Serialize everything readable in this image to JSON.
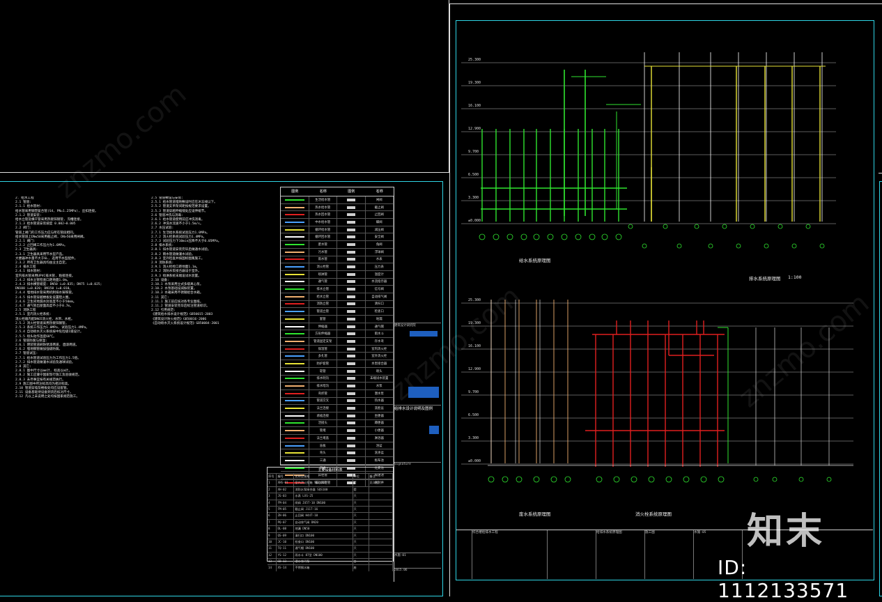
{
  "drawing": {
    "notes_left": "2. 给水工程\n2.1 管道:\n2.1.1 给水管材:\n给水管采用钢塑复合管(S4, PN=1.25MPa), 丝扣连接。\n2.1.2 管道安装:\n给水立管及横干管采用热镀锌钢管, 沟槽连接。\n2.1.3 给水管道安装坡度 0.002~0.005\n2.2 阀门:\n管道上阀门的工作压力应与所在管段相同。\n给水管道上DN≤50采用截止阀, DN>50采用闸阀。\n2.2.1 阀门:\n2.2.2 止回阀工作压力为1.6MPa。\n2.3 卫生器具:\n2.3.1 卫生器具采用节水型产品。\n大便器冲水量不大于6L, 选用节水型配件。\n2.3.2 所有卫生器具均由业主自定。\n2.4 排水工程\n2.4.1 排水管材:\n室内排水管采用UPVC排水管, 粘接连接。\n2.4.2 排水立管检查口距地面1.0m。\n2.4.3 排水横管坡度: DN50 i=0.035; DN75 i=0.025;\nDN100 i=0.020; DN150 i=0.010。\n2.4.4 埋地排水管采用机制排水铸铁管。\n2.4.5 排水管穿越楼板处设置阻火圈。\n2.4.6 卫生间地漏水封高度不小于50mm。\n2.4.7 通气管出屋面高度不小于0.7m。\n2.5 消防工程\n2.5.1 室内消火栓系统:\n消火栓箱内配DN65消火栓、水带、水枪。\n2.5.2 消火栓管道采用热镀锌钢管。\n2.5.3 系统工作压力1.0MPa, 试验压力1.4MPa。\n2.5.4 自动喷水灭火系统按中危险级I级设计。\n2.5.5 喷头动作温度68℃。\n2.6 管道防腐与保温:\n2.6.1 明装管道刷防锈漆两道, 面漆两道。\n2.6.2 埋地钢管做加强级防腐。\n2.7 管道试压:\n2.7.1 给水管道试验压力为工作压力1.5倍。\n2.7.2 排水管道做灌水试验及通球试验。\n2.8 其它:\n2.8.1 图中尺寸以mm计, 标高以m计。\n2.8.2 施工应遵守国家现行施工及验收规范。\n2.8.3 未尽事宜按有关规范执行。\n2.9 施工图中所注标高均为相对标高。\n2.10 管道穿墙及楼板处均应设套管。\n2.11 设备基础待设备到货后核对尺寸。\n2.12 凡以上未说明之处均按国家规范施工。",
    "notes_right": "2.5 管道敷设与安装:\n2.5.1 给水管道埋地敷设时应在冰冻线以下。\n2.5.2 管道支吊架间距按规范要求设置。\n2.5.3 管道穿越伸缩缝处应设伸缩节。\n2.6 管道冲洗与消毒:\n2.6.1 给水管道使用前应冲洗消毒。\n2.6.2 冲洗水流速不小于1.5m/s。\n2.7 水压试验:\n2.7.1 生活给水系统试验压力1.0MPa。\n2.7.2 消火栓系统试验压力1.4MPa。\n2.7.3 试验压力下10min压降不大于0.05MPa。\n2.8 排水系统:\n2.8.1 排水管道安装完毕后做通水试验。\n2.8.2 雨水管道做灌水试验。\n2.8.3 室外检查井按国标图集施工。\n2.9 消防系统:\n2.9.1 消火栓栓口距地面1.1m。\n2.9.2 消防水泵接合器设于室外。\n2.9.3 喷淋系统末端设试水装置。\n2.10 设备:\n2.10.1 水泵采用立式多级离心泵。\n2.10.2 水泵基础设减振装置。\n2.10.3 水箱采用不锈钢组合水箱。\n2.11 其它:\n2.11.1 施工前应核对各专业图纸。\n2.11.2 管道安装完毕后标注管道标识。\n2.12 引用规范:\n《建筑给水排水设计规范》GB50015-2003\n《建筑设计防火规范》GB50016-2006\n《自动喷水灭火系统设计规范》GB50084-2001",
    "legend_header": [
      "图例",
      "名称",
      "图例",
      "名称"
    ],
    "legend_rows": [
      [
        "生活给水管",
        "闸阀"
      ],
      [
        "热水给水管",
        "截止阀"
      ],
      [
        "热水回水管",
        "止回阀"
      ],
      [
        "中水给水管",
        "蝶阀"
      ],
      [
        "循环给水管",
        "减压阀"
      ],
      [
        "循环回水管",
        "安全阀"
      ],
      [
        "废水管",
        "角阀"
      ],
      [
        "污水管",
        "浮球阀"
      ],
      [
        "雨水管",
        "水表"
      ],
      [
        "消火栓管",
        "压力表"
      ],
      [
        "喷淋管",
        "温度计"
      ],
      [
        "通气管",
        "水流指示器"
      ],
      [
        "排水立管",
        "信号阀"
      ],
      [
        "给水立管",
        "自动排气阀"
      ],
      [
        "消防立管",
        "清扫口"
      ],
      [
        "管道立管",
        "检查口"
      ],
      [
        "套管",
        "地漏"
      ],
      [
        "伸缩器",
        "通气帽"
      ],
      [
        "方形伸缩器",
        "雨水斗"
      ],
      [
        "管道固定支架",
        "存水弯"
      ],
      [
        "保温管",
        "室内消火栓"
      ],
      [
        "多孔管",
        "室外消火栓"
      ],
      [
        "防护套管",
        "水泵接合器"
      ],
      [
        "软管",
        "喷头"
      ],
      [
        "排水明沟",
        "末端试水装置"
      ],
      [
        "排水暗沟",
        "水泵"
      ],
      [
        "弯折管",
        "潜水泵"
      ],
      [
        "管道交叉",
        "热水器"
      ],
      [
        "法兰连接",
        "洗脸盆"
      ],
      [
        "承插连接",
        "坐便器"
      ],
      [
        "活接头",
        "蹲便器"
      ],
      [
        "管堵",
        "小便器"
      ],
      [
        "法兰堵盖",
        "淋浴器"
      ],
      [
        "盲板",
        "浴盆"
      ],
      [
        "弯头",
        "洗涤盆"
      ],
      [
        "三通",
        "拖布池"
      ],
      [
        "四通",
        "化粪池"
      ],
      [
        "异径管",
        "隔油池"
      ],
      [
        "偏心异径管",
        "水封井"
      ]
    ],
    "equipment_table": {
      "title": "主要设备材料表",
      "headers": [
        "序号",
        "编号",
        "名称及规格",
        "单位",
        "备注"
      ],
      "rows": [
        [
          "1",
          "XHS-01",
          "室内消火栓箱 SG24A65",
          "套",
          "见详图"
        ],
        [
          "2",
          "XH-02",
          "消防水泵接合器 SQS100",
          "套",
          ""
        ],
        [
          "3",
          "JS-03",
          "水表 LXS-25",
          "只",
          ""
        ],
        [
          "4",
          "FM-04",
          "闸阀 Z45T-10 DN100",
          "只",
          ""
        ],
        [
          "5",
          "FM-05",
          "截止阀 J11T-16",
          "只",
          ""
        ],
        [
          "6",
          "ZH-06",
          "止回阀 H44T-10",
          "只",
          ""
        ],
        [
          "7",
          "PQ-07",
          "自动排气阀 DN20",
          "只",
          ""
        ],
        [
          "8",
          "DL-08",
          "地漏 DN50",
          "只",
          ""
        ],
        [
          "9",
          "QS-09",
          "清扫口 DN100",
          "只",
          ""
        ],
        [
          "10",
          "JC-10",
          "检查口 DN100",
          "只",
          ""
        ],
        [
          "11",
          "TQ-11",
          "通气帽 DN100",
          "只",
          ""
        ],
        [
          "12",
          "YS-12",
          "雨水斗 87型 DN100",
          "只",
          ""
        ],
        [
          "13",
          "SB-13",
          "潜水排污泵",
          "台",
          ""
        ],
        [
          "14",
          "XS-14",
          "不锈钢水箱",
          "座",
          ""
        ]
      ]
    },
    "captions": {
      "water_supply_system": "给水系统原理图",
      "drain_system_1": "排水系统原理图",
      "drain_system_2": "废水系统原理图",
      "fire_system": "消火栓系统原理图",
      "scale": "1:100"
    },
    "levels_top": [
      "25.300",
      "19.300",
      "16.100",
      "12.900",
      "9.700",
      "6.500",
      "3.300",
      "±0.000"
    ],
    "levels_bottom": [
      "25.300",
      "19.300",
      "16.100",
      "12.900",
      "9.700",
      "6.500",
      "3.300",
      "±0.000"
    ],
    "titleblock": {
      "project": "给排水设计说明及图例",
      "company": "建筑设计研究院",
      "drawing_no": "水施-01",
      "date": "2015.06",
      "signature": "Signature"
    },
    "bottombar": {
      "project": "综合楼给排水工程",
      "drawing_title": "给排水系统原理图",
      "drawing_no": "水施-05",
      "stage": "施工图"
    }
  },
  "watermark": {
    "logo": "知末",
    "id": "ID: 1112133571",
    "site": "znzmo.com"
  },
  "colors": {
    "frame": "#2fd6e6",
    "water_supply": "#2fe52f",
    "fire_pipe": "#e01f1f",
    "drain": "#e8e337",
    "hot_water": "#f0b070"
  }
}
